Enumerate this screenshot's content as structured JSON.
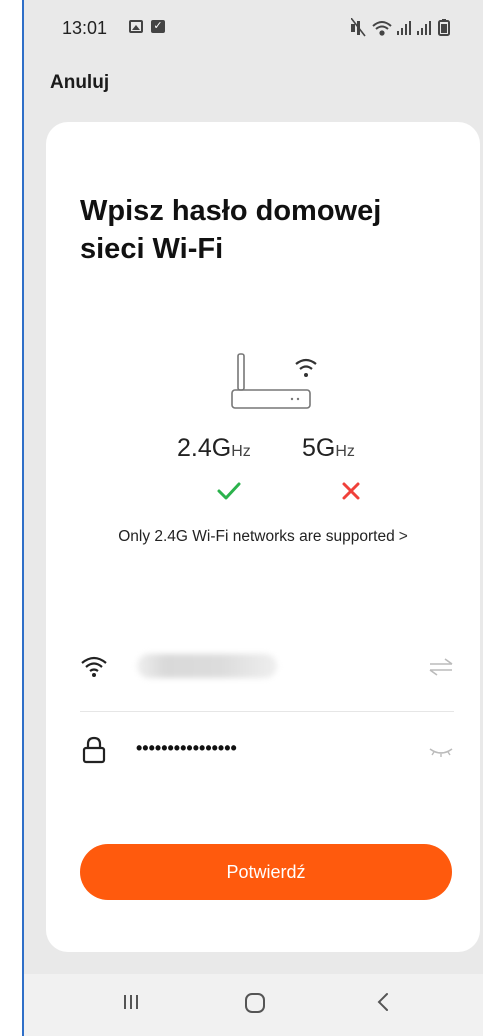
{
  "status_bar": {
    "time": "13:01",
    "icons": [
      "image-icon",
      "checkbox-icon",
      "mute-icon",
      "wifi-icon",
      "signal-icon",
      "signal-icon",
      "battery-icon"
    ]
  },
  "top_bar": {
    "cancel_label": "Anuluj"
  },
  "card": {
    "title": "Wpisz hasło domowej sieci Wi-Fi",
    "bands": {
      "band_24_number": "2.4G",
      "band_24_unit": "Hz",
      "band_24_status": "check",
      "band_5_number": "5G",
      "band_5_unit": "Hz",
      "band_5_status": "cross"
    },
    "support_note": "Only 2.4G Wi-Fi networks are supported",
    "support_note_chevron": ">",
    "network_field": {
      "value": "",
      "blurred": true
    },
    "password_field": {
      "value": "••••••••••••••••"
    },
    "confirm_label": "Potwierdź"
  },
  "colors": {
    "accent": "#ff5a0d",
    "ok": "#2bb24c",
    "error": "#f0403a",
    "frame_border": "#2f6fc8"
  },
  "nav_bar": {
    "icons": [
      "recent-apps-icon",
      "home-icon",
      "back-icon"
    ]
  }
}
